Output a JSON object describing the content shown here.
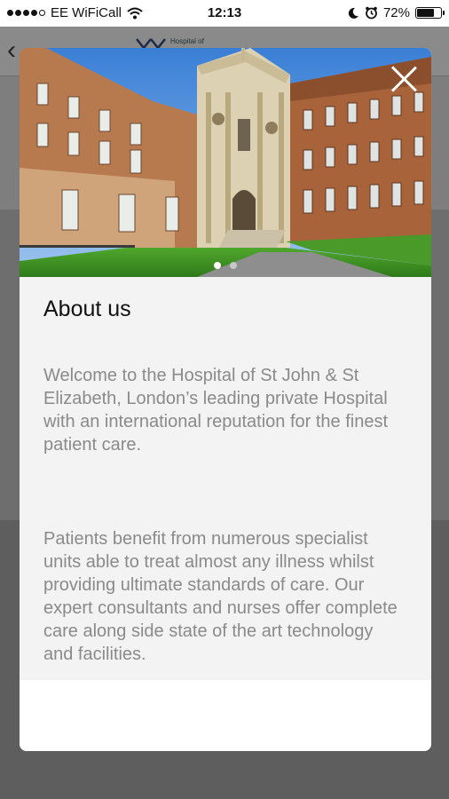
{
  "status_bar": {
    "carrier": "EE WiFiCall",
    "time": "12:13",
    "battery": "72%",
    "battery_level": 0.72
  },
  "background": {
    "logo_text": "Hospital of"
  },
  "modal": {
    "title": "About us",
    "paragraphs": [
      "Welcome to the Hospital of St John & St Elizabeth, London’s leading private Hospital with an international reputation for the finest patient care.",
      "Patients benefit from numerous specialist units able to treat almost any illness whilst providing ultimate standards of care. Our expert consultants and nurses offer complete care along side state of the art technology and facilities."
    ],
    "carousel_pages": 2,
    "active_page": 1
  },
  "icons": {
    "close": "close-icon",
    "back": "chevron-left-icon",
    "wifi": "wifi-icon",
    "moon": "moon-icon",
    "alarm": "alarm-icon",
    "battery": "battery-icon"
  },
  "colors": {
    "overlay": "#7b7b7b",
    "paragraph": "#8a8a8a",
    "title": "#111111",
    "content_bg": "#f3f3f3"
  }
}
